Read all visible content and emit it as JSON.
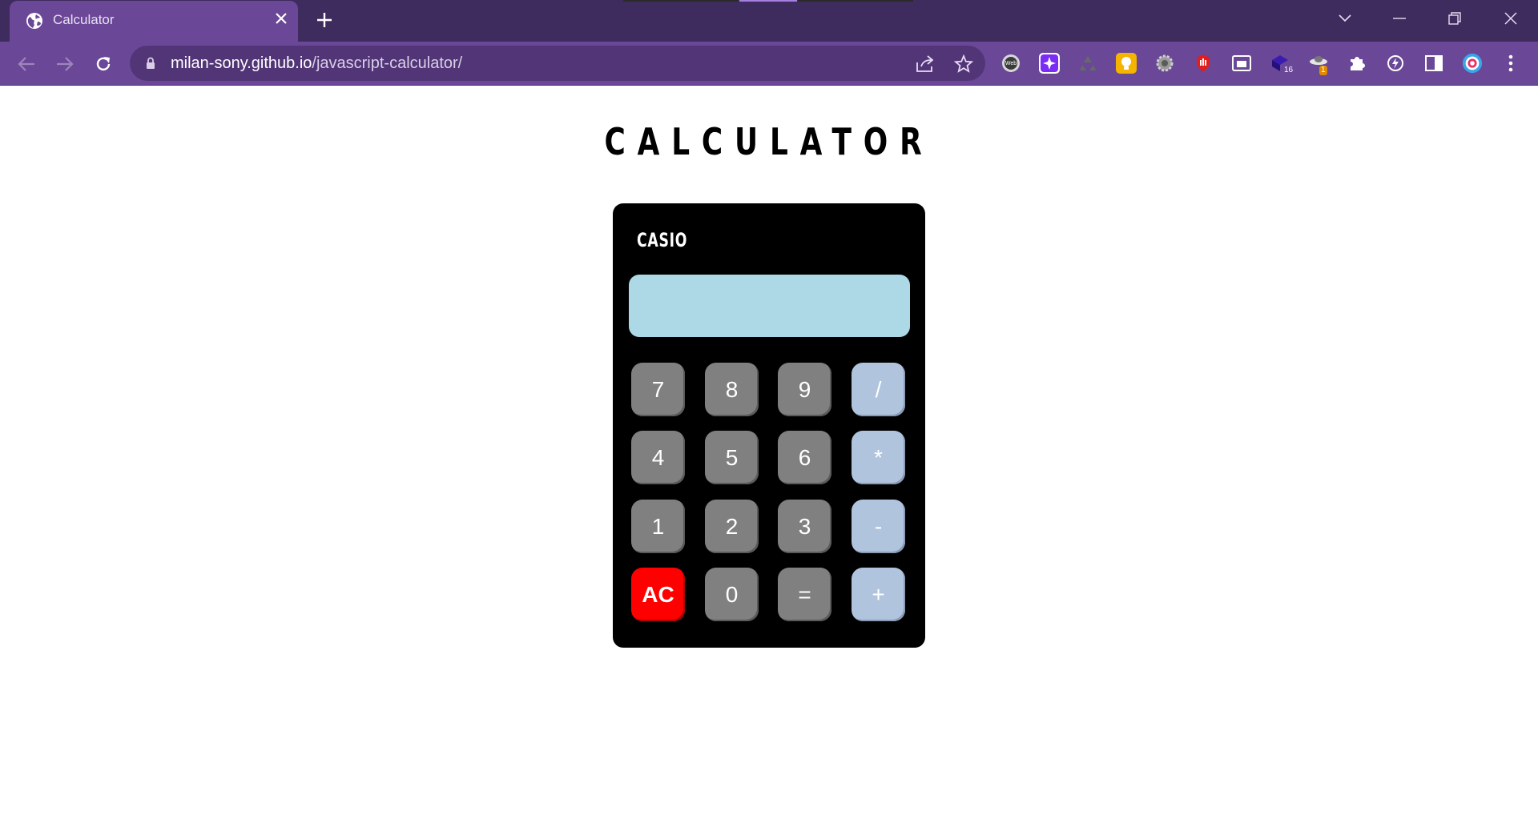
{
  "browser": {
    "tab": {
      "title": "Calculator",
      "favicon": "globe-icon",
      "close_icon": "close-icon"
    },
    "new_tab_icon": "plus-icon",
    "window_controls": [
      "chevron-down-icon",
      "minimize-icon",
      "restore-icon",
      "close-icon"
    ],
    "nav": {
      "back_icon": "arrow-left-icon",
      "forward_icon": "arrow-right-icon",
      "reload_icon": "reload-icon"
    },
    "address": {
      "host": "milan-sony.github.io",
      "path": "/javascript-calculator/",
      "lock_icon": "lock-icon",
      "share_icon": "share-icon",
      "bookmark_icon": "star-icon"
    },
    "extensions": [
      {
        "icon": "web-extension-icon",
        "badge": ""
      },
      {
        "icon": "sparkle-extension-icon",
        "badge": ""
      },
      {
        "icon": "recycle-extension-icon",
        "badge": ""
      },
      {
        "icon": "lightbulb-extension-icon",
        "badge": ""
      },
      {
        "icon": "gear-extension-icon",
        "badge": ""
      },
      {
        "icon": "hand-stop-extension-icon",
        "badge": ""
      },
      {
        "icon": "picture-in-picture-icon",
        "badge": ""
      },
      {
        "icon": "cube-extension-icon",
        "badge": "16"
      },
      {
        "icon": "ufo-extension-icon",
        "badge": "1"
      },
      {
        "icon": "puzzle-icon",
        "badge": ""
      },
      {
        "icon": "lightning-extension-icon",
        "badge": ""
      },
      {
        "icon": "side-panel-icon",
        "badge": ""
      },
      {
        "icon": "target-extension-icon",
        "badge": ""
      },
      {
        "icon": "kebab-menu-icon",
        "badge": ""
      }
    ],
    "colors": {
      "tabbar": "#3f2c5e",
      "active_tab": "#6b4797",
      "omnibox": "#523577"
    }
  },
  "page": {
    "title": "CALCULATOR",
    "calculator": {
      "brand": "CASIO",
      "display_value": "",
      "keys": [
        {
          "label": "7",
          "kind": "num"
        },
        {
          "label": "8",
          "kind": "num"
        },
        {
          "label": "9",
          "kind": "num"
        },
        {
          "label": "/",
          "kind": "op"
        },
        {
          "label": "4",
          "kind": "num"
        },
        {
          "label": "5",
          "kind": "num"
        },
        {
          "label": "6",
          "kind": "num"
        },
        {
          "label": "*",
          "kind": "op"
        },
        {
          "label": "1",
          "kind": "num"
        },
        {
          "label": "2",
          "kind": "num"
        },
        {
          "label": "3",
          "kind": "num"
        },
        {
          "label": "-",
          "kind": "op"
        },
        {
          "label": "AC",
          "kind": "clear"
        },
        {
          "label": "0",
          "kind": "num"
        },
        {
          "label": "=",
          "kind": "num"
        },
        {
          "label": "+",
          "kind": "op"
        }
      ],
      "colors": {
        "body": "#000000",
        "display": "#add8e6",
        "number_key": "#808080",
        "operator_key": "#b0c4de",
        "clear_key": "#ff0000"
      }
    }
  }
}
